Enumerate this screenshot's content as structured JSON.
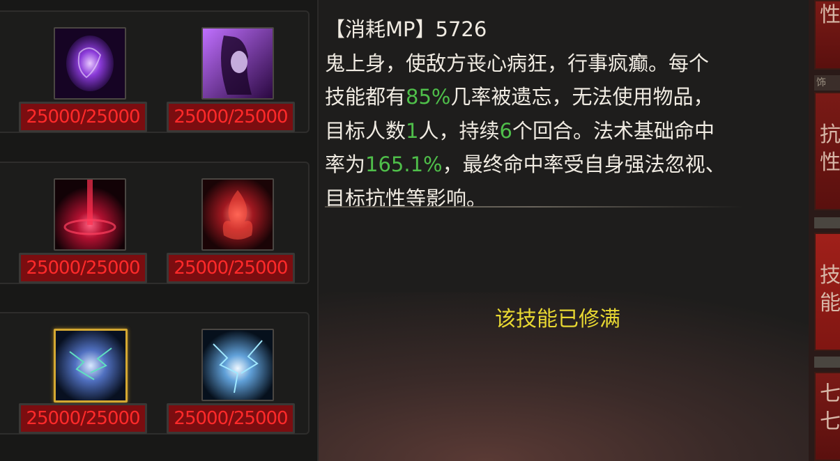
{
  "skills": [
    {
      "hp": "25000/25000",
      "icon": "purple-orb-icon"
    },
    {
      "hp": "25000/25000",
      "icon": "purple-woman-icon"
    },
    {
      "hp": "25000/25000",
      "icon": "red-vortex-icon"
    },
    {
      "hp": "25000/25000",
      "icon": "red-flame-icon"
    },
    {
      "hp": "25000/25000",
      "icon": "blue-lightning-orb-icon",
      "selected": true
    },
    {
      "hp": "25000/25000",
      "icon": "blue-lightning-burst-icon"
    }
  ],
  "description": {
    "cost_label": "【消耗MP】",
    "cost_value": "5726",
    "line_a": "鬼上身，使敌方丧心病狂，行事疯癫。每个",
    "line_b1": "技能都有",
    "pct1": "85%",
    "line_b2": "几率被遗忘，无法使用物品，",
    "line_c1": "目标人数",
    "targets": "1",
    "line_c2": "人，持续",
    "turns": "6",
    "line_c3": "个回合。法术基础命中",
    "line_d1": "率为",
    "hit_rate": "165.1%",
    "line_d2": "，最终命中率受自身强法忽视、",
    "line_e": "目标抗性等影响。"
  },
  "status_text": "该技能已修满",
  "right_tabs": {
    "tab1": "性",
    "label": "饰",
    "tab2": "抗性",
    "tab3": "技能",
    "tab4": "七七"
  },
  "colors": {
    "highlight": "#4fbf4a",
    "maxed": "#e8d832",
    "hp_text": "#ff2a2a",
    "hp_bg": "#7b0d10",
    "selected_border": "#d4a832"
  }
}
